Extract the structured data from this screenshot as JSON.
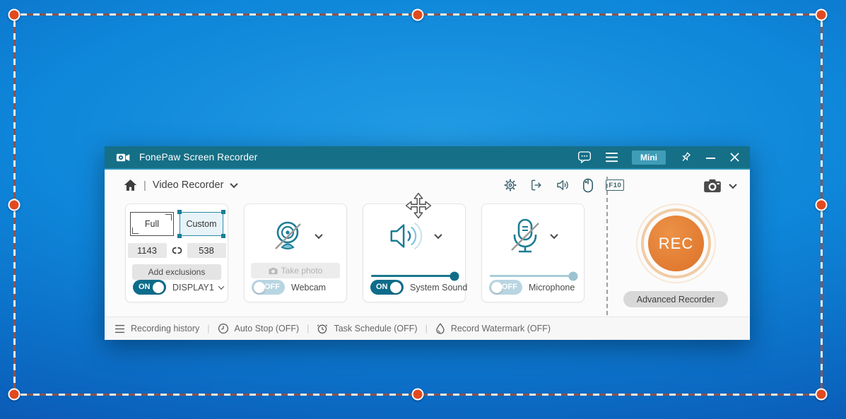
{
  "titlebar": {
    "app_title": "FonePaw Screen Recorder",
    "mini_label": "Mini"
  },
  "toolbar": {
    "divider": "|",
    "nav_label": "Video Recorder",
    "hotkey_label": "F10"
  },
  "panels": {
    "display": {
      "full_label": "Full",
      "custom_label": "Custom",
      "width_value": "1143",
      "height_value": "538",
      "add_exclusions_label": "Add exclusions",
      "toggle_label": "ON",
      "monitor_label": "DISPLAY1"
    },
    "webcam": {
      "take_photo_label": "Take photo",
      "toggle_label": "OFF",
      "label": "Webcam"
    },
    "system_sound": {
      "toggle_label": "ON",
      "label": "System Sound",
      "volume_percent": 97
    },
    "microphone": {
      "toggle_label": "OFF",
      "label": "Microphone",
      "volume_percent": 97
    }
  },
  "recorder": {
    "rec_label": "REC",
    "advanced_label": "Advanced Recorder"
  },
  "statusbar": {
    "divider": "|",
    "items": [
      {
        "label": "Recording history"
      },
      {
        "label": "Auto Stop (OFF)"
      },
      {
        "label": "Task Schedule (OFF)"
      },
      {
        "label": "Record Watermark (OFF)"
      }
    ]
  },
  "colors": {
    "titlebar_teal": "#156f87",
    "accent_teal": "#1d7d95",
    "rec_orange": "#dd7128",
    "selection_handle_orange": "#e2491f",
    "desktop_blue": "#0e86d9"
  }
}
